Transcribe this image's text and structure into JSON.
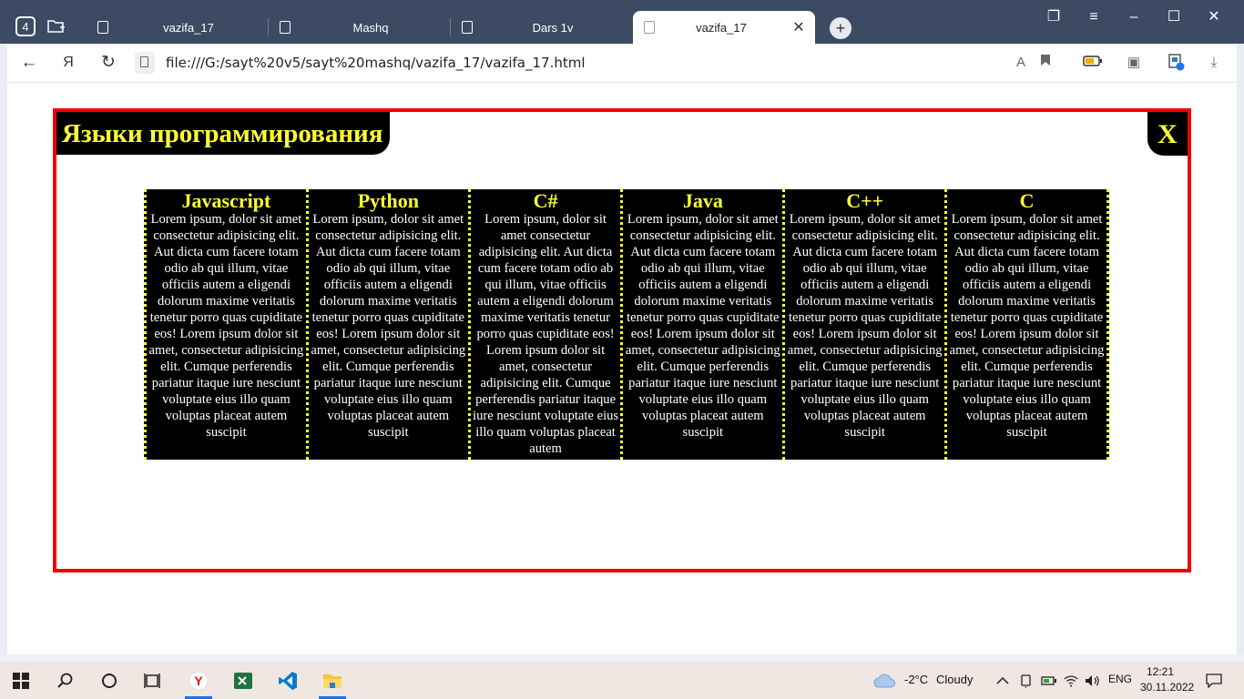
{
  "browser": {
    "tab_count": "4",
    "tabs": [
      {
        "title": "vazifa_17"
      },
      {
        "title": "Mashq"
      },
      {
        "title": "Dars 1v"
      },
      {
        "title": "vazifa_17"
      }
    ],
    "url": "file:///G:/sayt%20v5/sayt%20mashq/vazifa_17/vazifa_17.html"
  },
  "page": {
    "heading": "Языки программирования",
    "close_label": "X",
    "columns": [
      {
        "title": "Javascript",
        "text": "Lorem ipsum, dolor sit amet consectetur adipisicing elit. Aut dicta cum facere totam odio ab qui illum, vitae officiis autem a eligendi dolorum maxime veritatis tenetur porro quas cupiditate eos! Lorem ipsum dolor sit amet, consectetur adipisicing elit. Cumque perferendis pariatur itaque iure nesciunt voluptate eius illo quam voluptas placeat autem suscipit"
      },
      {
        "title": "Python",
        "text": "Lorem ipsum, dolor sit amet consectetur adipisicing elit. Aut dicta cum facere totam odio ab qui illum, vitae officiis autem a eligendi dolorum maxime veritatis tenetur porro quas cupiditate eos! Lorem ipsum dolor sit amet, consectetur adipisicing elit. Cumque perferendis pariatur itaque iure nesciunt voluptate eius illo quam voluptas placeat autem suscipit"
      },
      {
        "title": "C#",
        "text": "Lorem ipsum, dolor sit amet consectetur adipisicing elit. Aut dicta cum facere totam odio ab qui illum, vitae officiis autem a eligendi dolorum maxime veritatis tenetur porro quas cupiditate eos! Lorem ipsum dolor sit amet, consectetur adipisicing elit. Cumque perferendis pariatur itaque iure nesciunt voluptate eius illo quam voluptas placeat autem"
      },
      {
        "title": "Java",
        "text": "Lorem ipsum, dolor sit amet consectetur adipisicing elit. Aut dicta cum facere totam odio ab qui illum, vitae officiis autem a eligendi dolorum maxime veritatis tenetur porro quas cupiditate eos! Lorem ipsum dolor sit amet, consectetur adipisicing elit. Cumque perferendis pariatur itaque iure nesciunt voluptate eius illo quam voluptas placeat autem suscipit"
      },
      {
        "title": "C++",
        "text": "Lorem ipsum, dolor sit amet consectetur adipisicing elit. Aut dicta cum facere totam odio ab qui illum, vitae officiis autem a eligendi dolorum maxime veritatis tenetur porro quas cupiditate eos! Lorem ipsum dolor sit amet, consectetur adipisicing elit. Cumque perferendis pariatur itaque iure nesciunt voluptate eius illo quam voluptas placeat autem suscipit"
      },
      {
        "title": "C",
        "text": "Lorem ipsum, dolor sit amet consectetur adipisicing elit. Aut dicta cum facere totam odio ab qui illum, vitae officiis autem a eligendi dolorum maxime veritatis tenetur porro quas cupiditate eos! Lorem ipsum dolor sit amet, consectetur adipisicing elit. Cumque perferendis pariatur itaque iure nesciunt voluptate eius illo quam voluptas placeat autem suscipit"
      }
    ]
  },
  "taskbar": {
    "weather_temp": "-2°C",
    "weather_text": "Cloudy",
    "language": "ENG",
    "time": "12:21",
    "date": "30.11.2022"
  },
  "colors": {
    "frame_border": "#ee0000",
    "heading_bg": "#000000",
    "heading_text": "#ffff33",
    "tab_strip": "#3c4a63"
  },
  "icons": [
    "tab-counter-icon",
    "folder-add-icon",
    "page-favicon-icon",
    "close-icon",
    "plus-icon",
    "bookmarks-icon",
    "menu-icon",
    "minimize-icon",
    "maximize-icon",
    "back-icon",
    "yandex-icon",
    "reload-icon",
    "translate-icon",
    "bookmark-icon",
    "battery-icon",
    "collections-icon",
    "extension-icon",
    "download-icon",
    "windows-start-icon",
    "search-icon",
    "cortana-icon",
    "task-view-icon",
    "yandex-browser-icon",
    "excel-icon",
    "vscode-icon",
    "file-explorer-icon",
    "cloud-icon",
    "chevron-up-icon",
    "wifi-icon",
    "volume-icon",
    "notifications-icon"
  ]
}
